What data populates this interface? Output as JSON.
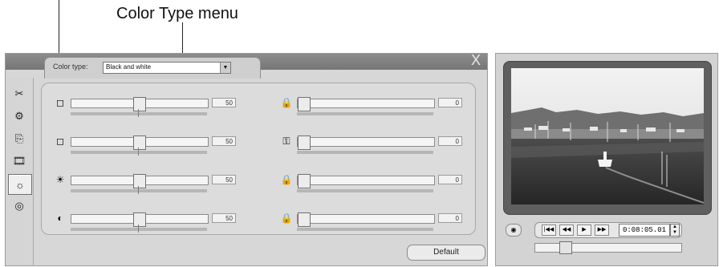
{
  "callout": {
    "label": "Color Type menu"
  },
  "window": {
    "close_glyph": "X",
    "color_type_label": "Color type:",
    "color_type_value": "Black and white",
    "dropdown_glyph": "▼"
  },
  "sidebar": {
    "items": [
      {
        "icon": "✂"
      },
      {
        "icon": "⚙"
      },
      {
        "icon": "⎘"
      },
      {
        "icon": "🎞"
      },
      {
        "icon": "☼"
      },
      {
        "icon": "◎"
      }
    ]
  },
  "controls": {
    "left_sliders": [
      {
        "icon": "◻",
        "value": "50",
        "level": 50
      },
      {
        "icon": "◻",
        "value": "50",
        "level": 50
      },
      {
        "icon": "☀",
        "value": "50",
        "level": 50
      },
      {
        "icon": "◐",
        "value": "50",
        "level": 50
      }
    ],
    "right_sliders": [
      {
        "icon": "🔒",
        "value": "0",
        "level": 0
      },
      {
        "icon": "⚿",
        "value": "0",
        "level": 0
      },
      {
        "icon": "🔒",
        "value": "0",
        "level": 0
      },
      {
        "icon": "🔒",
        "value": "0",
        "level": 0
      }
    ],
    "default_label": "Default"
  },
  "player": {
    "buttons": {
      "first": "|◀◀",
      "prev": "◀◀",
      "play": "▶",
      "next": "▶▶"
    },
    "timecode": "0:08:05.01",
    "spin_up": "▲",
    "spin_down": "▼",
    "scrub_level": 0.18
  }
}
